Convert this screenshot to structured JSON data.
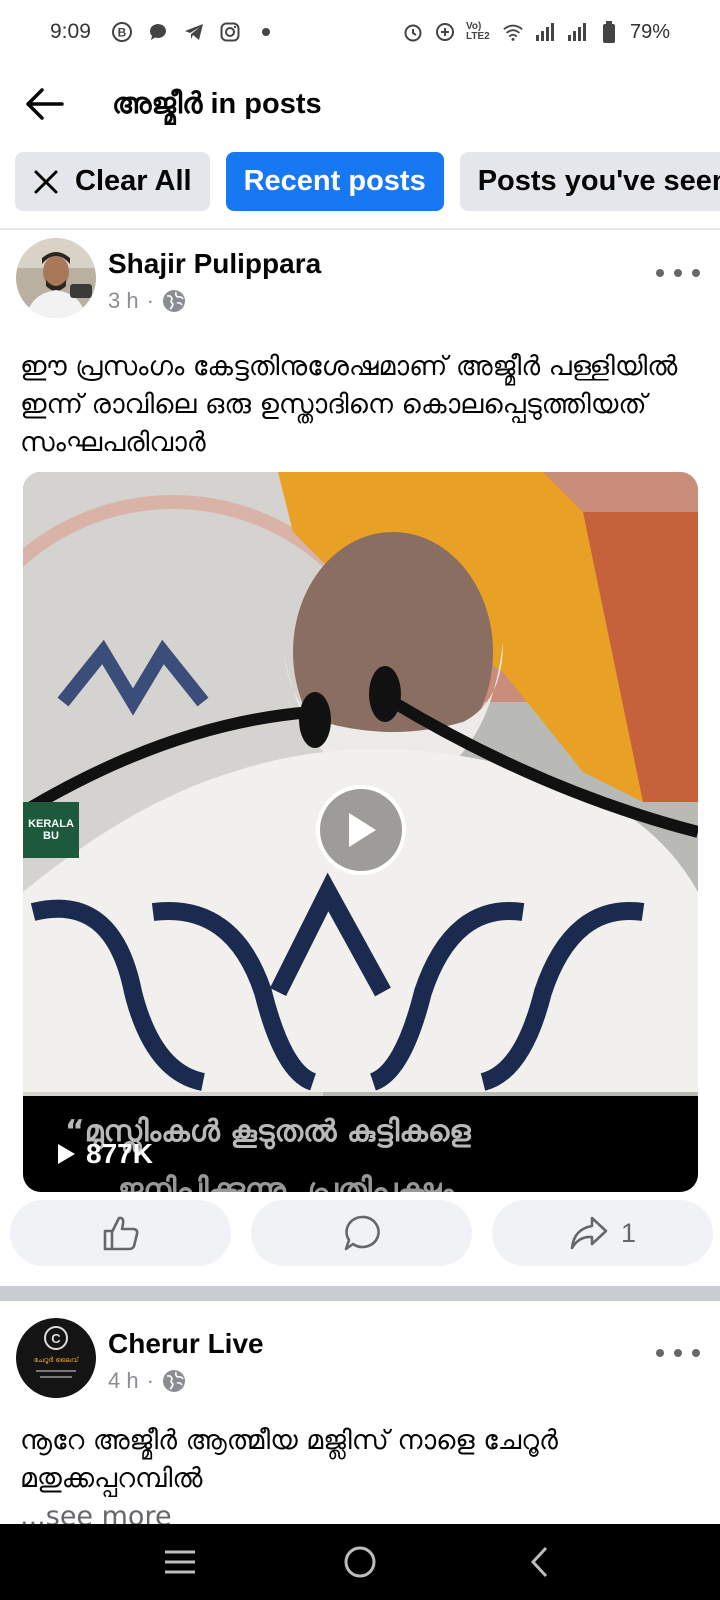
{
  "status_bar": {
    "time": "9:09",
    "battery": "79%",
    "left_icons": [
      "b-icon",
      "chat-bubble-icon",
      "telegram-icon",
      "instagram-icon",
      "dot-icon"
    ],
    "right_icons": [
      "alarm-icon",
      "data-saver-icon",
      "volte-icon",
      "wifi-icon",
      "signal-icon",
      "signal-icon",
      "battery-icon"
    ],
    "volte_label": "Vo) LTE2"
  },
  "header": {
    "title": "അജ്മീർ in posts"
  },
  "filters": {
    "clear_all": "Clear All",
    "recent_posts": "Recent posts",
    "posts_seen": "Posts you've seen",
    "accent": "#1877f2"
  },
  "posts": [
    {
      "author": "Shajir Pulippara",
      "time": "3 h",
      "separator": "·",
      "text": "ഈ പ്രസംഗം കേട്ടതിനുശേഷമാണ് അജ്മീർ പള്ളിയിൽ ഇന്ന് രാവിലെ ഒരു ഉസ്താദിനെ കൊലപ്പെടുത്തിയത് സംഘപരിവാർ",
      "video": {
        "caption_line1": "“മുസ്ലിംകൾ കൂടുതൽ കുട്ടികളെ",
        "caption_line2": "ജനിപ്പിക്കുന്നു, പ്രതിപക്ഷം",
        "views": "877K",
        "watermark": "KERALA BU"
      },
      "shares": "1"
    },
    {
      "author": "Cherur Live",
      "time": "4 h",
      "separator": "·",
      "avatar_text": "ചേറൂർ ലൈവ്",
      "text": "നൂറേ അജ്മീർ ആത്മീയ മജ്ലിസ് നാളെ ചേറൂർ മതുക്കപ്പറമ്പിൽ",
      "see_more": "...see more"
    }
  ]
}
